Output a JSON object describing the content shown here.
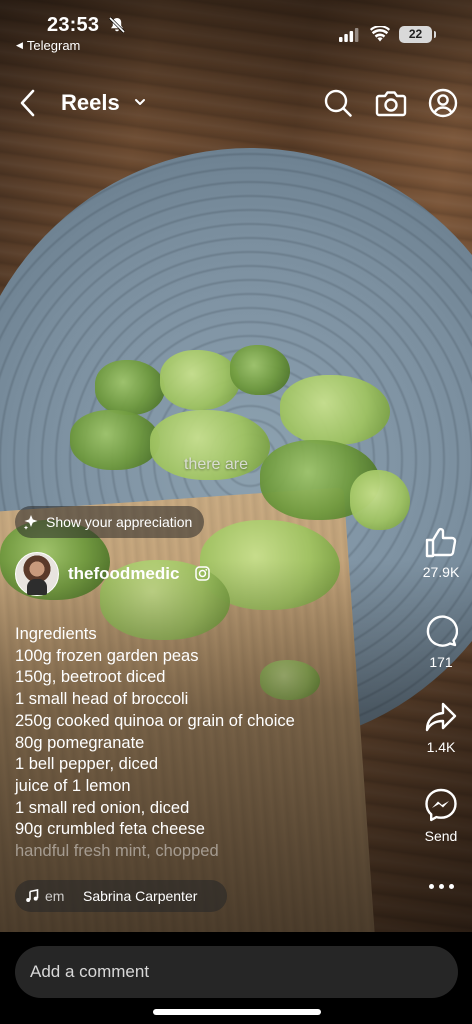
{
  "status_bar": {
    "time": "23:53",
    "back_app": "Telegram",
    "battery": "22"
  },
  "header": {
    "title": "Reels"
  },
  "reel": {
    "caption_word": "there are",
    "appreciation_label": "Show your appreciation",
    "username": "thefoodmedic",
    "description_lines": [
      "Ingredients",
      "100g frozen garden peas",
      "150g, beetroot diced",
      "1 small head of broccoli",
      "250g cooked quinoa or grain of choice",
      "80g pomegranate",
      "1 bell pepper, diced",
      "juice of 1 lemon",
      "1 small red onion, diced",
      "90g crumbled feta cheese",
      "handful fresh mint, chopped"
    ],
    "music": {
      "track": "em",
      "artist": "Sabrina Carpenter"
    }
  },
  "actions": {
    "likes": "27.9K",
    "comments": "171",
    "shares": "1.4K",
    "send_label": "Send"
  },
  "comment_input": {
    "placeholder": "Add a comment"
  },
  "icons": [
    "mute-icon",
    "signal-icon",
    "wifi-icon",
    "back-icon",
    "chevron-down-icon",
    "search-icon",
    "camera-icon",
    "profile-icon",
    "sparkle-icon",
    "instagram-icon",
    "music-note-icon",
    "thumbs-up-icon",
    "comment-icon",
    "share-icon",
    "messenger-icon",
    "more-icon"
  ]
}
